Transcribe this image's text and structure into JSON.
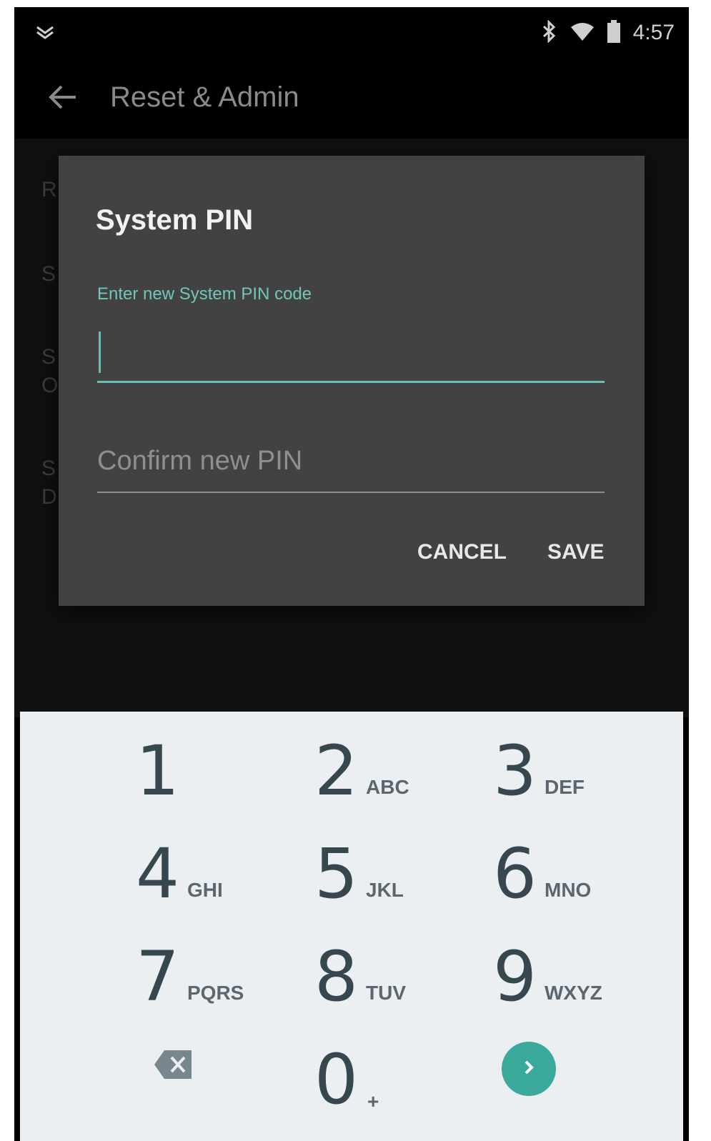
{
  "status_bar": {
    "time": "4:57",
    "icons": [
      "notification-chevron-icon",
      "bluetooth-icon",
      "wifi-icon",
      "battery-icon"
    ]
  },
  "app_bar": {
    "title": "Reset & Admin",
    "back_icon": "arrow-left-icon"
  },
  "background_list": {
    "items": [
      {
        "title": "R",
        "subtitle": ""
      },
      {
        "title": "S",
        "subtitle": ""
      },
      {
        "title": "S",
        "subtitle": "O"
      },
      {
        "title": "S",
        "subtitle": "D"
      }
    ]
  },
  "dialog": {
    "title": "System PIN",
    "pin_field": {
      "label": "Enter new System PIN code",
      "value": ""
    },
    "confirm_field": {
      "placeholder": "Confirm new PIN",
      "value": ""
    },
    "cancel_label": "CANCEL",
    "save_label": "SAVE"
  },
  "keypad": {
    "keys": [
      {
        "num": "1",
        "letters": ""
      },
      {
        "num": "2",
        "letters": "ABC"
      },
      {
        "num": "3",
        "letters": "DEF"
      },
      {
        "num": "4",
        "letters": "GHI"
      },
      {
        "num": "5",
        "letters": "JKL"
      },
      {
        "num": "6",
        "letters": "MNO"
      },
      {
        "num": "7",
        "letters": "PQRS"
      },
      {
        "num": "8",
        "letters": "TUV"
      },
      {
        "num": "9",
        "letters": "WXYZ"
      }
    ],
    "zero": {
      "num": "0",
      "letters": "+"
    },
    "backspace_icon": "backspace-icon",
    "next_icon": "chevron-right-icon",
    "accent_color": "#3aa89a"
  },
  "colors": {
    "dialog_bg": "#424242",
    "accent": "#66bfb3",
    "keypad_bg": "#eceff1"
  }
}
